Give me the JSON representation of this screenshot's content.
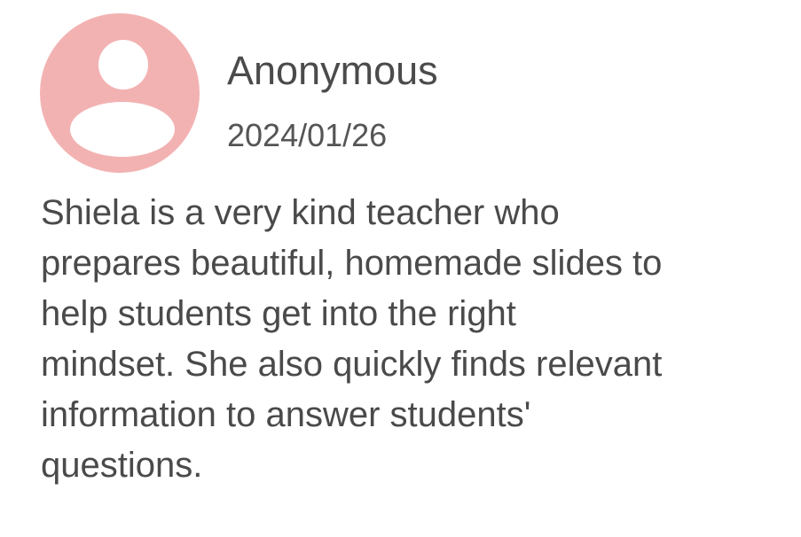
{
  "review": {
    "avatar_icon": "default-user-avatar-icon",
    "avatar_color": "#f3b2b2",
    "reviewer_name": "Anonymous",
    "date": "2024/01/26",
    "text": "Shiela is a very kind teacher who\nprepares beautiful, homemade slides to\nhelp students get into the right\nmindset. She also quickly finds relevant\ninformation to answer students'\nquestions."
  }
}
